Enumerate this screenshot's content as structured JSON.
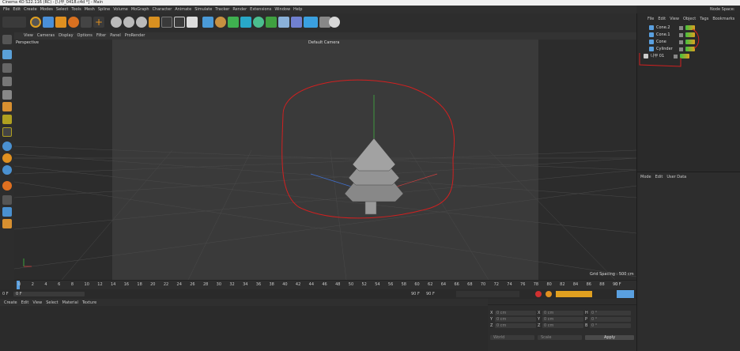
{
  "window": {
    "title": "Cinema 4D S22.116 (RC) - [나무_0418.c4d *] - Main"
  },
  "menubar": {
    "items": [
      "File",
      "Edit",
      "Create",
      "Modes",
      "Select",
      "Tools",
      "Mesh",
      "Spline",
      "Volume",
      "MoGraph",
      "Character",
      "Animate",
      "Simulate",
      "Tracker",
      "Render",
      "Extensions",
      "Window",
      "Help"
    ],
    "node_space_label": "Node Space:"
  },
  "viewport": {
    "menu": [
      "View",
      "Cameras",
      "Display",
      "Options",
      "Filter",
      "Panel",
      "ProRender"
    ],
    "view_name": "Perspective",
    "camera_label": "Default Camera",
    "grid_spacing": "Grid Spacing : 500 cm"
  },
  "timeline": {
    "ticks": [
      "0",
      "2",
      "4",
      "6",
      "8",
      "10",
      "12",
      "14",
      "16",
      "18",
      "20",
      "22",
      "24",
      "26",
      "28",
      "30",
      "32",
      "34",
      "36",
      "38",
      "40",
      "42",
      "44",
      "46",
      "48",
      "50",
      "52",
      "54",
      "56",
      "58",
      "60",
      "62",
      "64",
      "66",
      "68",
      "70",
      "72",
      "74",
      "76",
      "78",
      "80",
      "82",
      "84",
      "86",
      "88",
      "90"
    ],
    "current_frame": "0 F",
    "start_frame": "0 F",
    "min_frame": "0 F",
    "end_frame": "90 F",
    "max_frame": "90 F"
  },
  "material_manager": {
    "menu": [
      "Create",
      "Edit",
      "View",
      "Select",
      "Material",
      "Texture"
    ]
  },
  "object_manager": {
    "menu": [
      "File",
      "Edit",
      "View",
      "Object",
      "Tags",
      "Bookmarks"
    ],
    "objects": [
      {
        "name": "Cone.2",
        "icon": "cone-icon"
      },
      {
        "name": "Cone.1",
        "icon": "cone-icon"
      },
      {
        "name": "Cone",
        "icon": "cone-icon"
      },
      {
        "name": "Cylinder",
        "icon": "cylinder-icon"
      },
      {
        "name": "나무 01",
        "icon": "null-group-icon"
      }
    ]
  },
  "attribute_manager": {
    "menu": [
      "Mode",
      "Edit",
      "User Data"
    ]
  },
  "coordinates": {
    "rows": [
      {
        "axis": "X",
        "pos": "0 cm",
        "axis2": "X",
        "size": "0 cm",
        "axis3": "H",
        "rot": "0 °"
      },
      {
        "axis": "Y",
        "pos": "0 cm",
        "axis2": "Y",
        "size": "0 cm",
        "axis3": "P",
        "rot": "0 °"
      },
      {
        "axis": "Z",
        "pos": "0 cm",
        "axis2": "Z",
        "size": "0 cm",
        "axis3": "B",
        "rot": "0 °"
      }
    ],
    "mode_world": "World",
    "mode_scale": "Scale",
    "apply_label": "Apply"
  },
  "colors": {
    "accent_orange": "#f0a030",
    "annotation_red": "#d22020",
    "axis_x": "#d04040",
    "axis_y": "#40c040",
    "axis_z": "#4070d0",
    "active_tool": "#ffb000"
  }
}
